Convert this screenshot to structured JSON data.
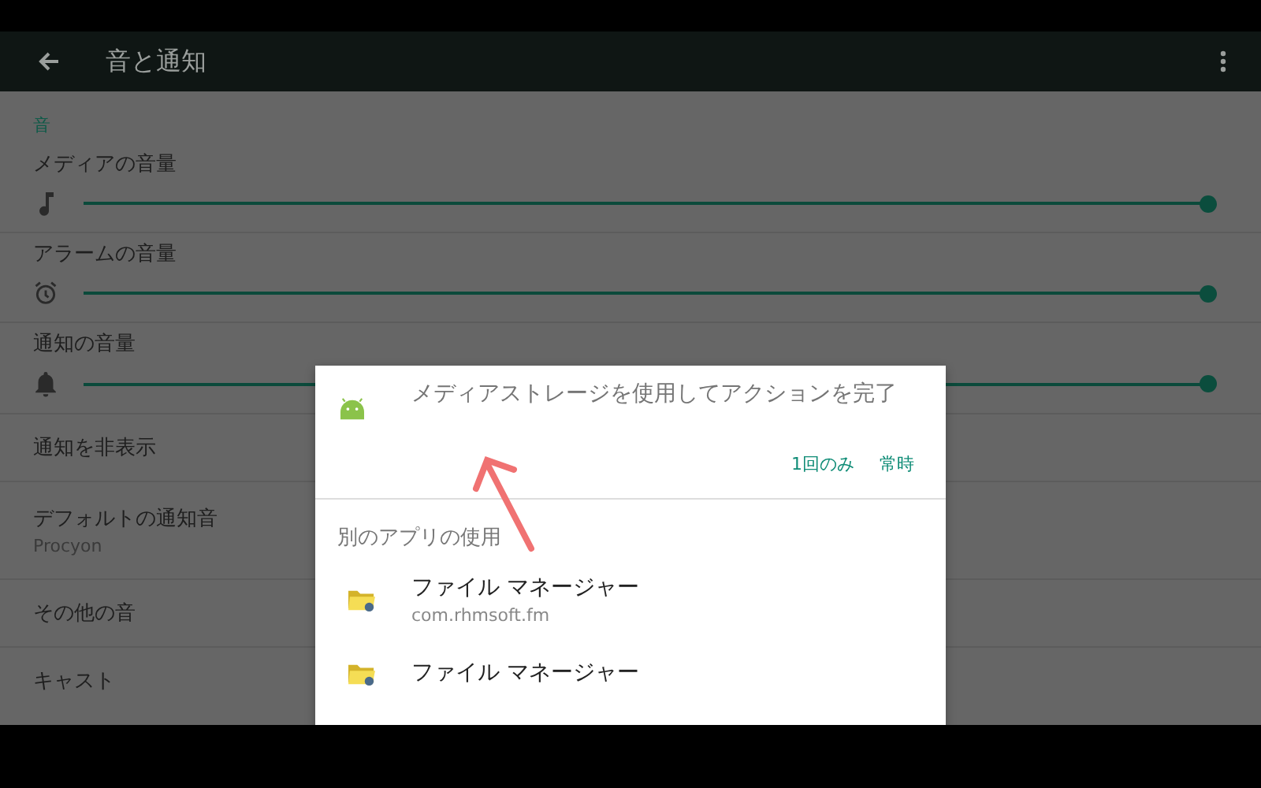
{
  "app_bar": {
    "title": "音と通知"
  },
  "section": "音",
  "volume_rows": [
    {
      "label": "メディアの音量",
      "level": 1.0
    },
    {
      "label": "アラームの音量",
      "level": 1.0
    },
    {
      "label": "通知の音量",
      "level": 1.0
    }
  ],
  "setting_rows": [
    {
      "label": "通知を非表示"
    },
    {
      "label": "デフォルトの通知音",
      "summary": "Procyon"
    },
    {
      "label": "その他の音"
    },
    {
      "label": "キャスト"
    }
  ],
  "dialog": {
    "title": "メディアストレージを使用してアクションを完了",
    "buttons": [
      "1回のみ",
      "常時"
    ],
    "subheader": "別のアプリの使用",
    "apps": [
      {
        "name": "ファイル マネージャー",
        "package": "com.rhmsoft.fm"
      },
      {
        "name": "ファイル マネージャー"
      }
    ]
  }
}
